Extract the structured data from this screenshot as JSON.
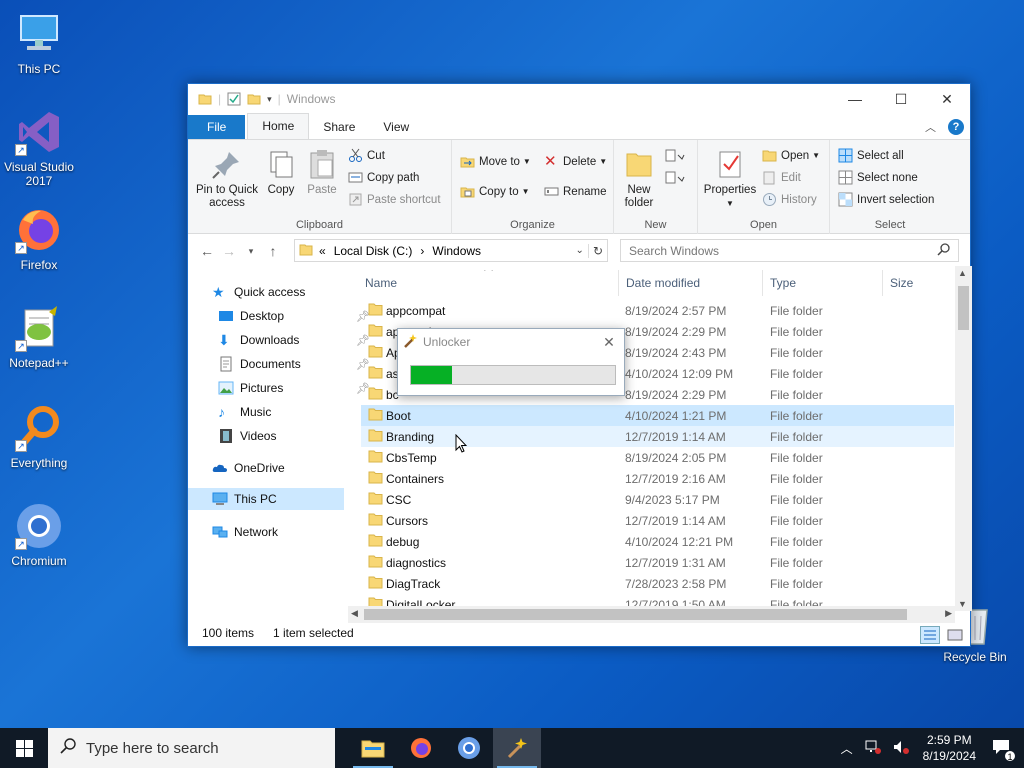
{
  "desktop": {
    "icons": [
      {
        "label": "This PC"
      },
      {
        "label": "Visual Studio 2017"
      },
      {
        "label": "Firefox"
      },
      {
        "label": "Notepad++"
      },
      {
        "label": "Everything"
      },
      {
        "label": "Chromium"
      },
      {
        "label": "Recycle Bin"
      }
    ]
  },
  "window": {
    "title": "Windows",
    "tabs": {
      "file": "File",
      "home": "Home",
      "share": "Share",
      "view": "View"
    },
    "ribbon": {
      "clipboard": {
        "pin": "Pin to Quick access",
        "copy": "Copy",
        "paste": "Paste",
        "cut": "Cut",
        "copy_path": "Copy path",
        "paste_shortcut": "Paste shortcut",
        "label": "Clipboard"
      },
      "organize": {
        "move_to": "Move to",
        "copy_to": "Copy to",
        "delete": "Delete",
        "rename": "Rename",
        "label": "Organize"
      },
      "new": {
        "new_folder": "New folder",
        "label": "New"
      },
      "open": {
        "properties": "Properties",
        "open": "Open",
        "edit": "Edit",
        "history": "History",
        "label": "Open"
      },
      "select": {
        "select_all": "Select all",
        "select_none": "Select none",
        "invert": "Invert selection",
        "label": "Select"
      }
    },
    "address": {
      "prefix": "«",
      "path1": "Local Disk (C:)",
      "sep": "›",
      "path2": "Windows"
    },
    "search_placeholder": "Search Windows",
    "nav": {
      "quick_access": "Quick access",
      "desktop": "Desktop",
      "downloads": "Downloads",
      "documents": "Documents",
      "pictures": "Pictures",
      "music": "Music",
      "videos": "Videos",
      "onedrive": "OneDrive",
      "this_pc": "This PC",
      "network": "Network"
    },
    "columns": {
      "name": "Name",
      "date": "Date modified",
      "type": "Type",
      "size": "Size"
    },
    "files": [
      {
        "name": "appcompat",
        "date": "8/19/2024 2:57 PM",
        "type": "File folder"
      },
      {
        "name": "apppatch",
        "date": "8/19/2024 2:29 PM",
        "type": "File folder"
      },
      {
        "name": "Ap",
        "date": "8/19/2024 2:43 PM",
        "type": "File folder"
      },
      {
        "name": "as",
        "date": "4/10/2024 12:09 PM",
        "type": "File folder"
      },
      {
        "name": "bc",
        "date": "8/19/2024 2:29 PM",
        "type": "File folder"
      },
      {
        "name": "Boot",
        "date": "4/10/2024 1:21 PM",
        "type": "File folder"
      },
      {
        "name": "Branding",
        "date": "12/7/2019 1:14 AM",
        "type": "File folder"
      },
      {
        "name": "CbsTemp",
        "date": "8/19/2024 2:05 PM",
        "type": "File folder"
      },
      {
        "name": "Containers",
        "date": "12/7/2019 2:16 AM",
        "type": "File folder"
      },
      {
        "name": "CSC",
        "date": "9/4/2023 5:17 PM",
        "type": "File folder"
      },
      {
        "name": "Cursors",
        "date": "12/7/2019 1:14 AM",
        "type": "File folder"
      },
      {
        "name": "debug",
        "date": "4/10/2024 12:21 PM",
        "type": "File folder"
      },
      {
        "name": "diagnostics",
        "date": "12/7/2019 1:31 AM",
        "type": "File folder"
      },
      {
        "name": "DiagTrack",
        "date": "7/28/2023 2:58 PM",
        "type": "File folder"
      },
      {
        "name": "DigitalLocker",
        "date": "12/7/2019 1:50 AM",
        "type": "File folder"
      }
    ],
    "status": {
      "count": "100 items",
      "selected": "1 item selected"
    }
  },
  "unlocker": {
    "title": "Unlocker",
    "progress": 0.2
  },
  "taskbar": {
    "search_placeholder": "Type here to search",
    "time": "2:59 PM",
    "date": "8/19/2024",
    "notification_count": "1"
  },
  "colors": {
    "accent": "#1979ca",
    "selection": "#cce8ff",
    "progress": "#06b025"
  }
}
